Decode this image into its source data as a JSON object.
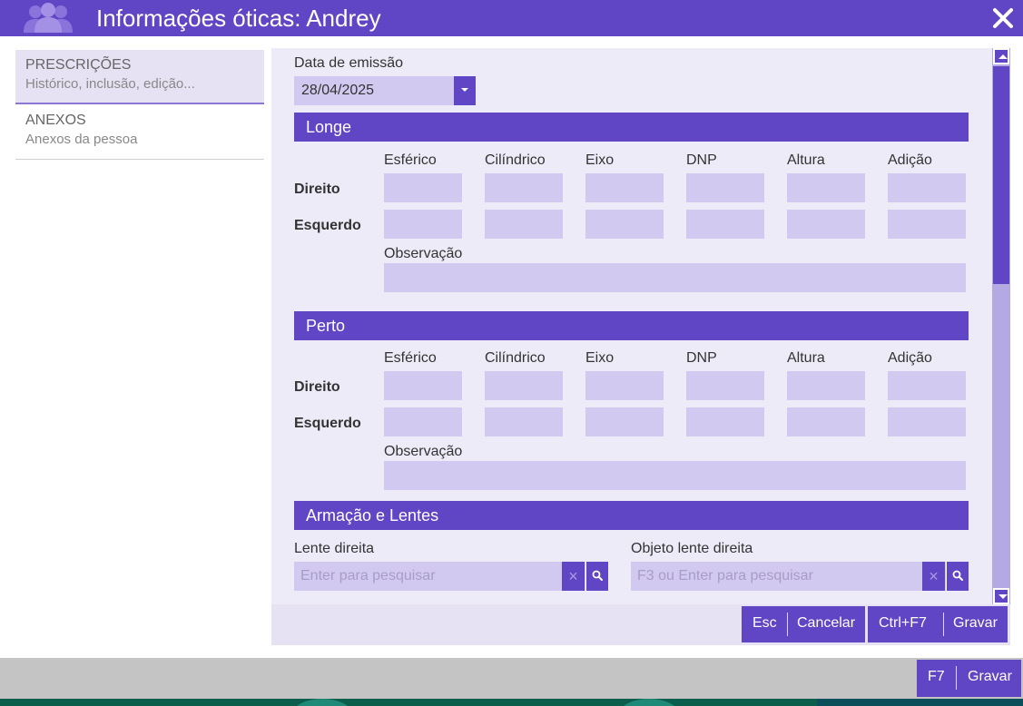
{
  "window": {
    "title": "Informações óticas: Andrey"
  },
  "sidebar": {
    "items": [
      {
        "title": "PRESCRIÇÕES",
        "subtitle": "Histórico, inclusão, edição..."
      },
      {
        "title": "ANEXOS",
        "subtitle": "Anexos da pessoa"
      }
    ]
  },
  "form": {
    "issue_date_label": "Data de emissão",
    "issue_date_value": "28/04/2025",
    "columns": [
      "Esférico",
      "Cilíndrico",
      "Eixo",
      "DNP",
      "Altura",
      "Adição"
    ],
    "rows": [
      "Direito",
      "Esquerdo"
    ],
    "observation_label": "Observação",
    "sections": {
      "longe": "Longe",
      "perto": "Perto",
      "armacao": "Armação e Lentes"
    },
    "right_lens_label": "Lente direita",
    "right_lens_placeholder": "Enter para pesquisar",
    "right_object_label": "Objeto lente direita",
    "right_object_placeholder": "F3 ou Enter para pesquisar"
  },
  "actions": {
    "cancel_key": "Esc",
    "cancel_label": "Cancelar",
    "save_key": "Ctrl+F7",
    "save_label": "Gravar"
  },
  "footer": {
    "save_key": "F7",
    "save_label": "Gravar"
  },
  "colors": {
    "accent": "#6045c4",
    "field": "#d2c9f0",
    "panel": "#eeebf8"
  }
}
